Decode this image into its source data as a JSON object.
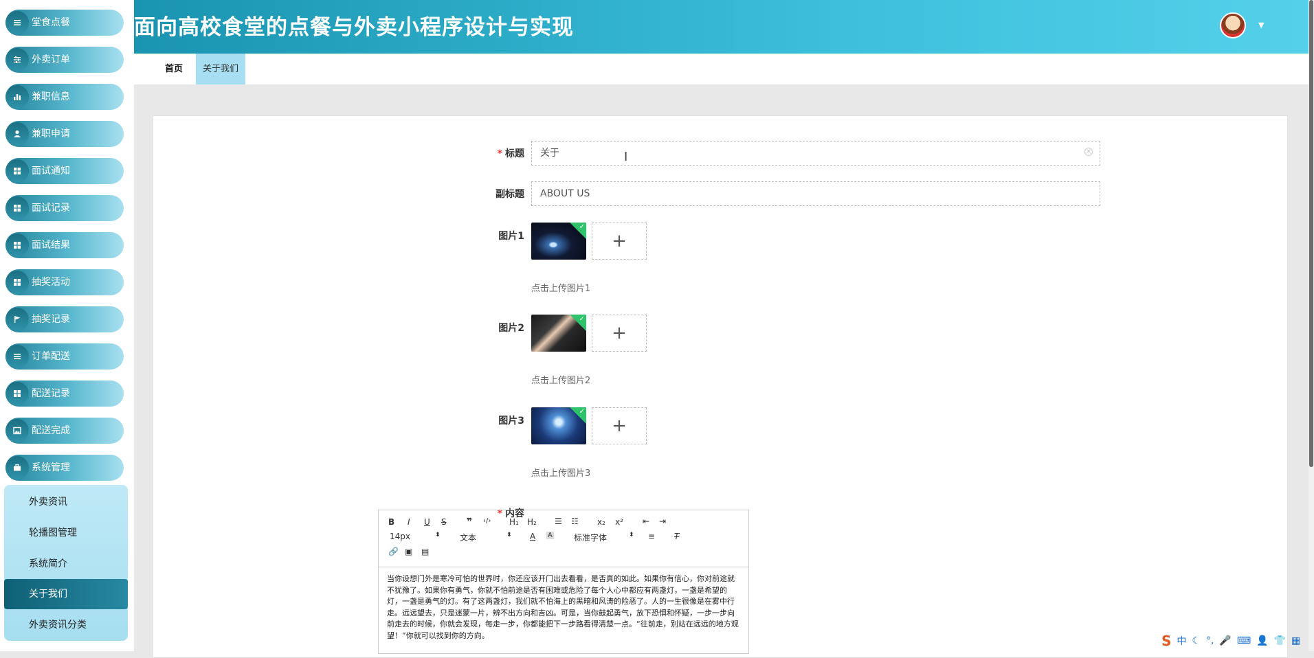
{
  "header": {
    "title": "面向高校食堂的点餐与外卖小程序设计与实现"
  },
  "sidebar": {
    "items": [
      {
        "label": "堂食点餐",
        "icon": "list-icon"
      },
      {
        "label": "外卖订单",
        "icon": "sliders-icon"
      },
      {
        "label": "兼职信息",
        "icon": "bar-chart-icon"
      },
      {
        "label": "兼职申请",
        "icon": "user-icon"
      },
      {
        "label": "面试通知",
        "icon": "grid-icon"
      },
      {
        "label": "面试记录",
        "icon": "grid-icon"
      },
      {
        "label": "面试结果",
        "icon": "grid-icon"
      },
      {
        "label": "抽奖活动",
        "icon": "grid-icon"
      },
      {
        "label": "抽奖记录",
        "icon": "flag-icon"
      },
      {
        "label": "订单配送",
        "icon": "list-icon"
      },
      {
        "label": "配送记录",
        "icon": "grid-icon"
      },
      {
        "label": "配送完成",
        "icon": "image-icon"
      },
      {
        "label": "系统管理",
        "icon": "briefcase-icon"
      }
    ],
    "submenu": [
      {
        "label": "外卖资讯"
      },
      {
        "label": "轮播图管理"
      },
      {
        "label": "系统简介"
      },
      {
        "label": "关于我们",
        "active": true
      },
      {
        "label": "外卖资讯分类"
      }
    ]
  },
  "tabs": {
    "home": "首页",
    "about": "关于我们"
  },
  "form": {
    "title_label": "标题",
    "title_value": "关于",
    "subtitle_label": "副标题",
    "subtitle_value": "ABOUT US",
    "images": [
      {
        "label": "图片1",
        "hint": "点击上传图片1"
      },
      {
        "label": "图片2",
        "hint": "点击上传图片2"
      },
      {
        "label": "图片3",
        "hint": "点击上传图片3"
      }
    ],
    "content_label": "内容",
    "required_mark": "*"
  },
  "editor": {
    "toolbar": {
      "bold": "B",
      "italic": "I",
      "underline": "U",
      "strike": "S",
      "quote": "❞",
      "code": "‹/›",
      "h1": "H₁",
      "h2": "H₂",
      "subscript": "x₂",
      "superscript": "x²",
      "size": "14px",
      "header_select": "文本",
      "font_select": "标准字体"
    },
    "body": "当你设想门外是寒冷可怕的世界时，你还应该开门出去看看，是否真的如此。如果你有信心，你对前途就不犹豫了。如果你有勇气，你就不怕前途是否有困难或危险了每个人心中都应有两盏灯，一盏是希望的灯，一盏是勇气的灯。有了这两盏灯，我们就不怕海上的黑暗和风涛的险恶了。人的一生很像是在雾中行走。远远望去，只是迷蒙一片，辨不出方向和吉凶。可是，当你鼓起勇气，放下恐惧和怀疑，一步一步向前走去的时候，你就会发现，每走一步，你都能把下一步路看得清楚一点。“往前走，别站在远远的地方观望！”你就可以找到你的方向。"
  },
  "ime": {
    "logo": "S",
    "mode": "中"
  },
  "colors": {
    "header_gradient_start": "#1a94b0",
    "header_gradient_end": "#55d0ea",
    "menu_dark": "#21849a",
    "submenu_bg": "#bfe9f7",
    "active_tab_bg": "#a8def1",
    "required": "#e33333",
    "check_green": "#2ec26a"
  }
}
